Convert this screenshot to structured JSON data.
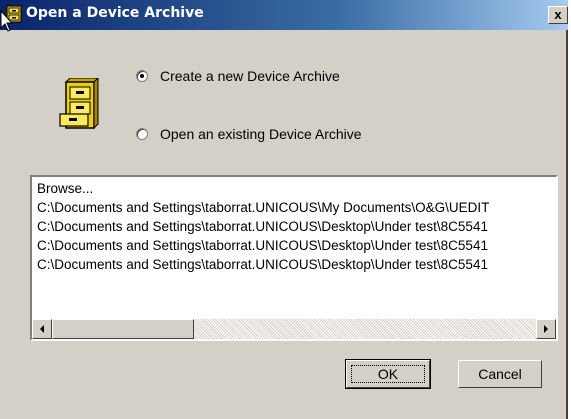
{
  "window": {
    "title": "Open a Device Archive",
    "close_label": "x"
  },
  "options": {
    "create_label": "Create a new Device Archive",
    "open_label": "Open an existing Device Archive",
    "selected": "create"
  },
  "list": {
    "items": [
      "Browse...",
      "C:\\Documents and Settings\\taborrat.UNICOUS\\My Documents\\O&G\\UEDIT",
      "C:\\Documents and Settings\\taborrat.UNICOUS\\Desktop\\Under test\\8C5541",
      "C:\\Documents and Settings\\taborrat.UNICOUS\\Desktop\\Under test\\8C5541",
      "C:\\Documents and Settings\\taborrat.UNICOUS\\Desktop\\Under test\\8C5541"
    ]
  },
  "buttons": {
    "ok_label": "OK",
    "cancel_label": "Cancel"
  },
  "icons": {
    "title": "file-cabinet-icon",
    "main": "file-cabinet-icon",
    "scroll_left": "arrow-left-icon",
    "scroll_right": "arrow-right-icon"
  }
}
